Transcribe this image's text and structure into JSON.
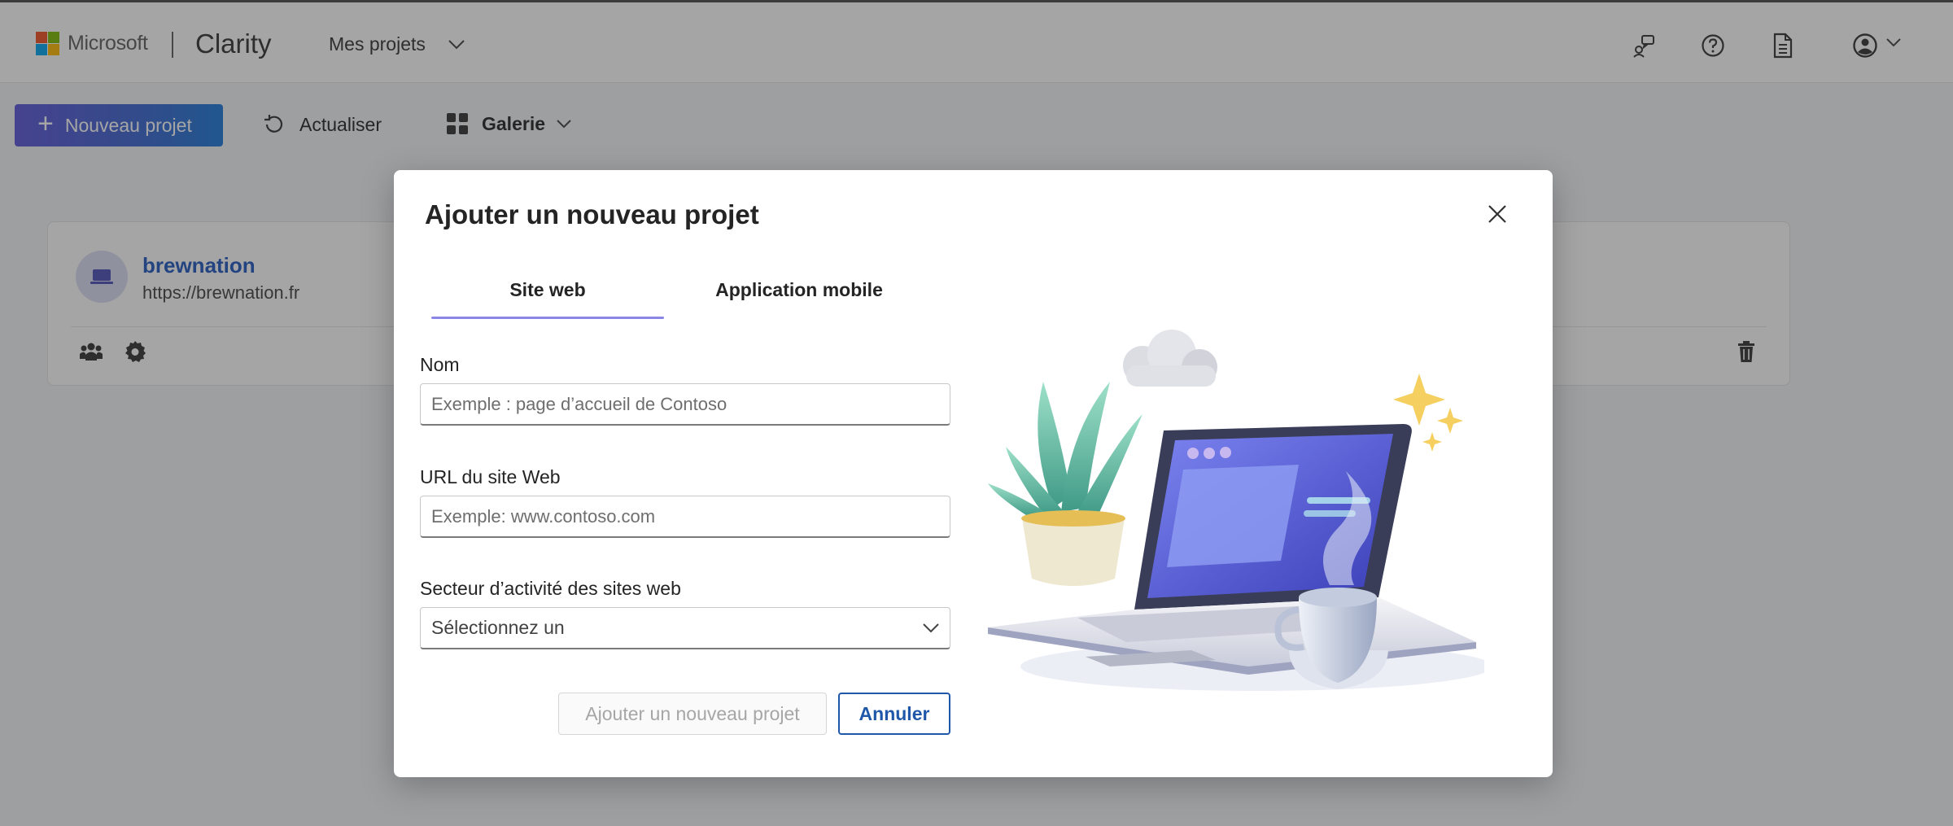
{
  "header": {
    "brand": "Microsoft",
    "product": "Clarity",
    "projects_dropdown": "Mes projets",
    "icons": [
      "feedback-icon",
      "help-icon",
      "document-icon",
      "account-icon"
    ]
  },
  "toolbar": {
    "new_project": "Nouveau projet",
    "refresh": "Actualiser",
    "view": "Galerie"
  },
  "project_card": {
    "name": "brewnation",
    "url": "https://brewnation.fr",
    "icons": [
      "team-icon",
      "settings-icon",
      "trash-icon"
    ]
  },
  "modal": {
    "title": "Ajouter un nouveau projet",
    "tabs": [
      {
        "label": "Site web",
        "selected": true
      },
      {
        "label": "Application mobile",
        "selected": false
      }
    ],
    "name_label": "Nom",
    "name_placeholder": "Exemple : page d’accueil de Contoso",
    "url_label": "URL du site Web",
    "url_placeholder": "Exemple: www.contoso.com",
    "industry_label": "Secteur d’activité des sites web",
    "industry_value": "Sélectionnez un",
    "add_button": "Ajouter un nouveau projet",
    "cancel_button": "Annuler"
  },
  "colors": {
    "accent": "#1f58a8",
    "tab_indicator": "#8a86e6",
    "primary_gradient": [
      "#5c55d9",
      "#1c78d8"
    ],
    "ms_logo": [
      "#f25022",
      "#7fba00",
      "#00a4ef",
      "#ffb900"
    ]
  }
}
